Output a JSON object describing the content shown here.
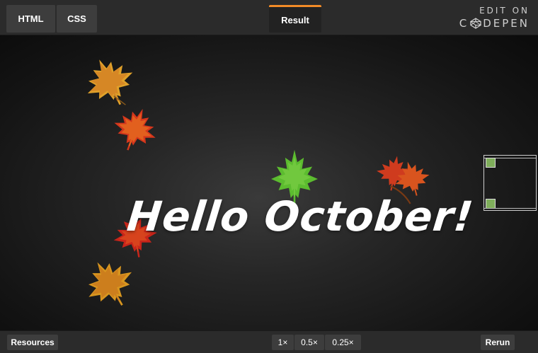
{
  "tabs": {
    "html_label": "HTML",
    "css_label": "CSS",
    "result_label": "Result"
  },
  "brand": {
    "edit_on": "EDIT ON",
    "codepen_left": "C",
    "codepen_right": "DEPEN"
  },
  "stage": {
    "headline": "Hello October!"
  },
  "bottom": {
    "resources_label": "Resources",
    "zoom_1x": "1×",
    "zoom_05x": "0.5×",
    "zoom_025x": "0.25×",
    "rerun_label": "Rerun"
  },
  "colors": {
    "accent": "#f28b27",
    "bar_bg": "#2b2b2b",
    "tab_bg": "#3d3d3d"
  }
}
